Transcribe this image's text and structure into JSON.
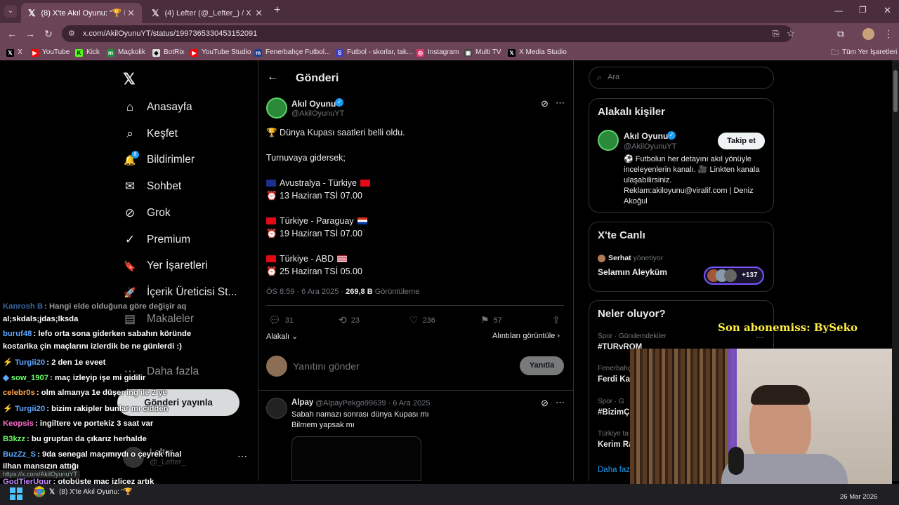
{
  "browser": {
    "tabs": [
      {
        "title": "(8) X'te Akıl Oyunu: \"🏆 Düny…",
        "active": true
      },
      {
        "title": "(4) Lefter (@_Lefter_) / X",
        "active": false
      }
    ],
    "new_tab": "+",
    "url": "x.com/AkilOyunuYT/status/1997365330453152091",
    "bookmarks": [
      {
        "label": "X",
        "icon": "x-icon",
        "color": "#000000"
      },
      {
        "label": "YouTube",
        "icon": "youtube-icon",
        "color": "#ff0000"
      },
      {
        "label": "Kick",
        "icon": "kick-icon",
        "color": "#53fc18"
      },
      {
        "label": "Maçkolik",
        "icon": "mackolik-icon",
        "color": "#1a8f3c"
      },
      {
        "label": "BotRix",
        "icon": "botrix-icon",
        "color": "#ffffff"
      },
      {
        "label": "YouTube Studio",
        "icon": "youtube-icon",
        "color": "#ff0000"
      },
      {
        "label": "Fenerbahçe Futbol...",
        "icon": "fenerbahce-icon",
        "color": "#1c3f94"
      },
      {
        "label": "Futbol - skorlar, tak...",
        "icon": "futbol-icon",
        "color": "#3d3dbf"
      },
      {
        "label": "Instagram",
        "icon": "instagram-icon",
        "color": "#e1306c"
      },
      {
        "label": "Multi TV",
        "icon": "multitv-icon",
        "color": "#444444"
      },
      {
        "label": "X Media Studio",
        "icon": "x-icon",
        "color": "#000000"
      }
    ],
    "all_bookmarks": "Tüm Yer İşaretleri"
  },
  "sidebar": {
    "items": [
      {
        "label": "Anasayfa",
        "icon": "home-icon",
        "glyph": "⌂"
      },
      {
        "label": "Keşfet",
        "icon": "search-icon",
        "glyph": "⌕"
      },
      {
        "label": "Bildirimler",
        "icon": "bell-icon",
        "glyph": "🔔"
      },
      {
        "label": "Sohbet",
        "icon": "mail-icon",
        "glyph": "✉"
      },
      {
        "label": "Grok",
        "icon": "grok-icon",
        "glyph": "⊘"
      },
      {
        "label": "Premium",
        "icon": "premium-icon",
        "glyph": "✓"
      },
      {
        "label": "Yer İşaretleri",
        "icon": "bookmark-icon",
        "glyph": "🔖"
      },
      {
        "label": "İçerik Üreticisi St...",
        "icon": "rocket-icon",
        "glyph": "🚀"
      },
      {
        "label": "Makaleler",
        "icon": "article-icon",
        "glyph": "▤"
      },
      {
        "label": "Daha fazla",
        "icon": "more-icon",
        "glyph": "⋯"
      }
    ],
    "notif_badge": "8",
    "post_button": "Gönderi yayınla",
    "account_name": "Lefter",
    "account_handle": "@_Lefter_"
  },
  "post": {
    "header": "Gönderi",
    "author": "Akıl Oyunu",
    "handle": "@AkilOyunuYT",
    "lines": [
      "🏆 Dünya Kupası saatleri belli oldu.",
      "Turnuvaya gidersek;",
      "Avustralya - Türkiye",
      "⏰ 13 Haziran TSİ 07.00",
      "Türkiye - Paraguay",
      "⏰ 19 Haziran TSİ 07.00",
      "Türkiye - ABD",
      "⏰ 25 Haziran TSİ 05.00"
    ],
    "meta_time": "ÖS 8:59 · 6 Ara 2025 ·",
    "views": "269,8 B",
    "views_label": "Görüntüleme",
    "replies": "31",
    "reposts": "23",
    "likes": "236",
    "bookmarks": "57",
    "relevance": "Alakalı",
    "quotes_link": "Alıntıları görüntüle",
    "reply_placeholder": "Yanıtını gönder",
    "reply_button": "Yanıtla"
  },
  "reply": {
    "author": "Alpay",
    "handle": "@AlpayPekgo99639 · 6 Ara 2025",
    "line1": "Sabah namazı sonrası dünya Kupası mı",
    "line2": "Bilmem yapsak mı"
  },
  "right": {
    "search_placeholder": "Ara",
    "related_title": "Alakalı kişiler",
    "related_name": "Akıl Oyunu",
    "related_handle": "@AkilOyunuYT",
    "follow": "Takip et",
    "bio": "⚽ Futbolun her detayını akıl yönüyle inceleyenlerin kanalı. 🎥 Linkten kanala ulaşabilirsiniz. Reklam:akiloyunu@viralif.com | Deniz Akoğul",
    "live_title": "X'te Canlı",
    "live_host": "Serhat",
    "live_host_suffix": "yönetiyor",
    "live_name": "Selamın Aleyküm",
    "live_count": "+137",
    "trends_title": "Neler oluyor?",
    "trends": [
      {
        "meta": "Spor · Gündemdekiler",
        "name": "#TURvROM"
      },
      {
        "meta": "Fenerbahç",
        "name": "Ferdi Ka"
      },
      {
        "meta": "Spor · G",
        "name": "#BizimÇ"
      },
      {
        "meta": "Türkiye ta",
        "name": "Kerim Ra"
      }
    ],
    "show_more": "Daha faz"
  },
  "overlay": {
    "subscriber": "Son abonemiss: BySeko",
    "status_url": "https://x.com/AkilOyunuYT"
  },
  "chat": [
    {
      "user": "Kanrosh B",
      "text": ": Hangi elde olduğuna göre değişir aq",
      "color": "#5fa8ff"
    },
    {
      "user": "",
      "text": "al;skdals;jdas;lksda",
      "color": "#ffffff"
    },
    {
      "user": "buruf48",
      "text": ": lefo orta sona giderken sabahın köründe",
      "color": "#5fa8ff"
    },
    {
      "user": "",
      "text": "kostarika çin maçlarını izlerdik be ne günlerdi :)",
      "color": "#ffffff"
    },
    {
      "user": "Turgii20",
      "text": ": 2 den 1e eveet",
      "color": "#5fa8ff"
    },
    {
      "user": "sow_1907",
      "text": ": maç izleyip işe mi gidilir",
      "color": "#6bff6b"
    },
    {
      "user": "celebr0s",
      "text": ": olm almanya 1e düşer ing ile 2 ye",
      "color": "#ffa64d"
    },
    {
      "user": "Turgii20",
      "text": ": bizim rakipler bunlar mı cidden",
      "color": "#5fa8ff"
    },
    {
      "user": "Keopsis",
      "text": ": ingiltere ve portekiz 3 saat var",
      "color": "#ff6bd0"
    },
    {
      "user": "B3kzz",
      "text": ": bu gruptan da çıkarız herhalde",
      "color": "#6bff6b"
    },
    {
      "user": "BuzZz_S",
      "text": ": 9da senegal maçımıydı o çeyrek final",
      "color": "#5fa8ff"
    },
    {
      "user": "",
      "text": "ilhan mansızın attığı",
      "color": "#ffffff"
    },
    {
      "user": "GodTierUgur",
      "text": ": otobüste maç izlicez artık",
      "color": "#c58cff"
    }
  ],
  "taskbar": {
    "app_title": "(8) X'te Akıl Oyunu: \"🏆",
    "date": "26 Mar 2026"
  }
}
